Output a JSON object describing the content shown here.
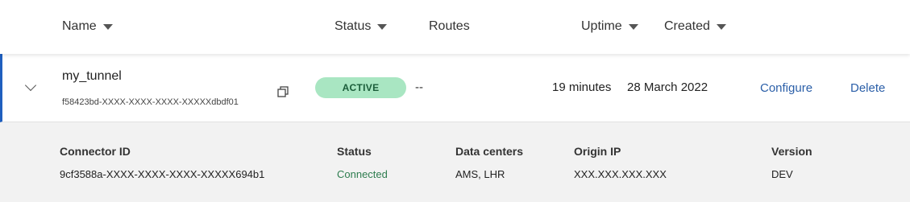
{
  "header": {
    "columns": [
      {
        "label": "Name",
        "sortable": true
      },
      {
        "label": "Status",
        "sortable": true
      },
      {
        "label": "Routes",
        "sortable": false
      },
      {
        "label": "Uptime",
        "sortable": true
      },
      {
        "label": "Created",
        "sortable": true
      }
    ]
  },
  "tunnel": {
    "name": "my_tunnel",
    "id": "f58423bd-XXXX-XXXX-XXXX-XXXXXdbdf01",
    "status": "ACTIVE",
    "routes": "--",
    "uptime": "19 minutes",
    "created": "28 March 2022",
    "actions": {
      "configure": "Configure",
      "delete": "Delete"
    }
  },
  "connector": {
    "headers": {
      "connector_id": "Connector ID",
      "status": "Status",
      "data_centers": "Data centers",
      "origin_ip": "Origin IP",
      "version": "Version"
    },
    "values": {
      "connector_id": "9cf3588a-XXXX-XXXX-XXXX-XXXXX694b1",
      "status": "Connected",
      "data_centers": "AMS, LHR",
      "origin_ip": "XXX.XXX.XXX.XXX",
      "version": "DEV"
    }
  },
  "colors": {
    "accent": "#1f5fbf",
    "link": "#2b5fa8",
    "active_badge_bg": "#a9e6c2",
    "active_badge_text": "#1b5d3a",
    "connected_text": "#2e7d4f"
  }
}
